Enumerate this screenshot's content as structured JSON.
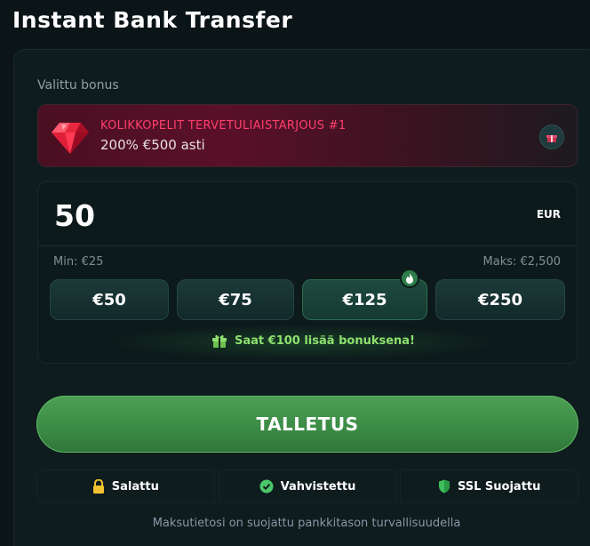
{
  "header": {
    "title": "Instant Bank Transfer"
  },
  "bonus": {
    "label": "Valittu bonus",
    "name": "KOLIKKOPELIT TERVETULIAISTARJOUS #1",
    "value": "200% €500 asti",
    "icon": "ruby-gem-icon",
    "accent": "#ff3f6c"
  },
  "amount": {
    "value": "50",
    "currency": "EUR",
    "min_label": "Min: €25",
    "max_label": "Maks: €2,500"
  },
  "presets": [
    {
      "label": "€50"
    },
    {
      "label": "€75"
    },
    {
      "label": "€125",
      "badge": "fire-icon"
    },
    {
      "label": "€250"
    }
  ],
  "bonus_note": "Saat €100 lisää bonuksena!",
  "deposit_button": {
    "label": "TALLETUS",
    "color": "#3f944a"
  },
  "trust": [
    {
      "label": "Salattu",
      "icon": "lock-icon"
    },
    {
      "label": "Vahvistettu",
      "icon": "verified-badge-icon"
    },
    {
      "label": "SSL Suojattu",
      "icon": "shield-icon"
    }
  ],
  "footer_note": "Maksutietosi on suojattu pankkitason turvallisuudella"
}
